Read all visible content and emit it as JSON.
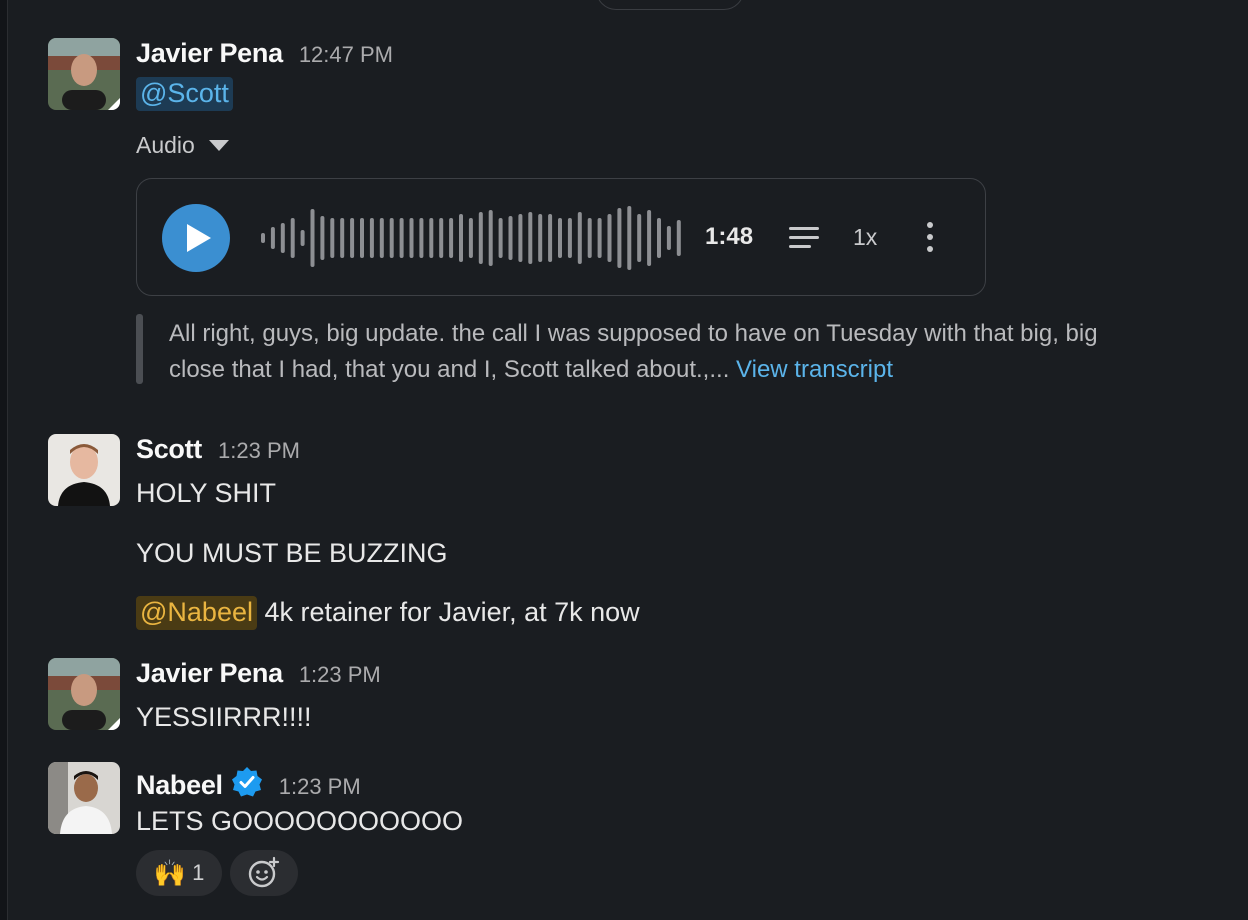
{
  "messages": [
    {
      "author": "Javier Pena",
      "time": "12:47 PM",
      "mention": "@Scott",
      "audio": {
        "label": "Audio",
        "duration": "1:48",
        "speed": "1x",
        "transcript_preview": "All right, guys, big update. the call I was supposed to have on Tuesday with that big, big close that I had, that you and I, Scott talked about.,...",
        "view_transcript": "View transcript"
      }
    },
    {
      "author": "Scott",
      "time": "1:23 PM",
      "lines": [
        "HOLY SHIT",
        "YOU MUST BE BUZZING"
      ],
      "mention": "@Nabeel",
      "mention_text": "4k retainer for Javier, at 7k now"
    },
    {
      "author": "Javier Pena",
      "time": "1:23 PM",
      "text": "YESSIIRRR!!!!"
    },
    {
      "author": "Nabeel",
      "time": "1:23 PM",
      "text": "LETS GOOOOOOOOOOO",
      "reaction": {
        "emoji": "🙌",
        "count": "1"
      }
    }
  ],
  "colors": {
    "background": "#1a1d21",
    "mention_blue": "#5bb4ea",
    "mention_yellow": "#eab541",
    "play_button": "#3b8fd1",
    "verified": "#1d9bf0"
  },
  "icons": [
    "play-icon",
    "waveform",
    "transcript-lines-icon",
    "more-vertical-icon",
    "caret-down-icon",
    "verified-badge-icon",
    "add-reaction-icon"
  ]
}
